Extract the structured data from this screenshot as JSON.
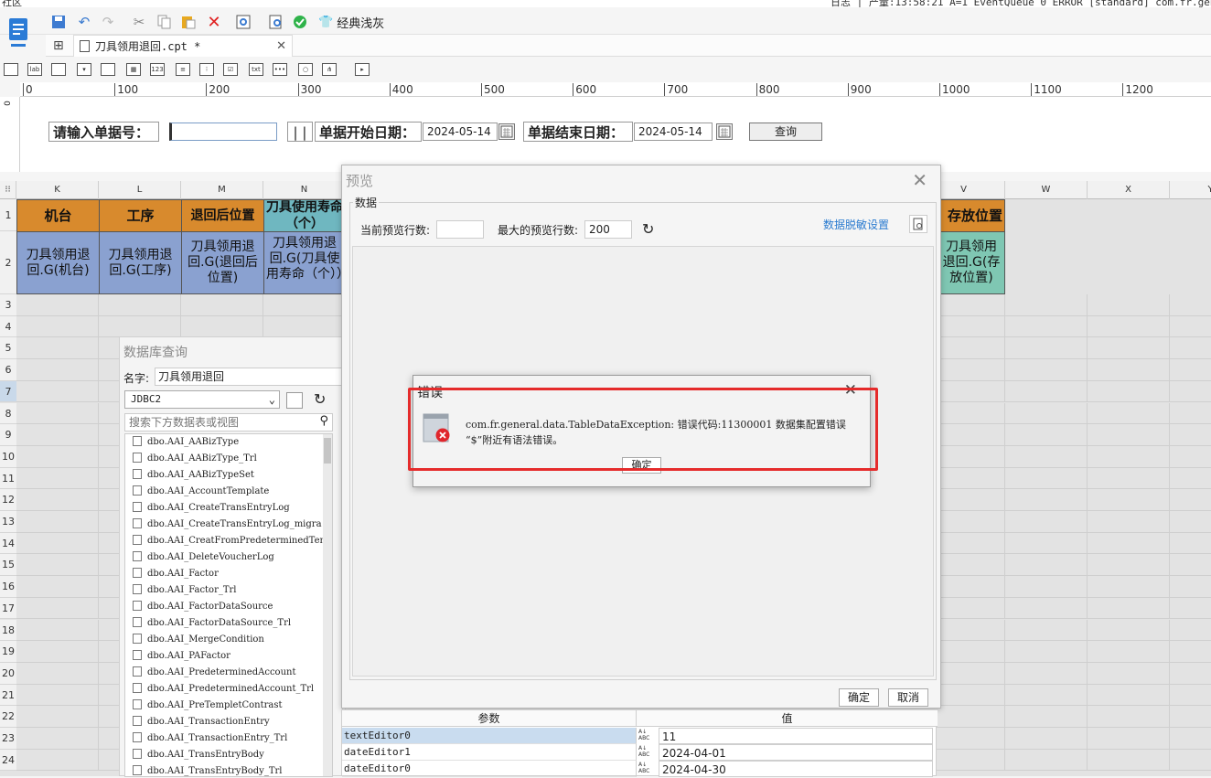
{
  "status_bar": {
    "log_text": "日志 | 产量:13:58:21 A=1 EventQueue 0 ERROR [standard] com.fr.general",
    "left_text": "社区"
  },
  "toolbar": {
    "theme_label": "经典浅灰"
  },
  "tabs": [
    {
      "label": "刀具领用退回.cpt *"
    }
  ],
  "ruler": {
    "marks": [
      "0",
      "100",
      "200",
      "300",
      "400",
      "500",
      "600",
      "700",
      "800",
      "900",
      "1000",
      "1100",
      "1200"
    ]
  },
  "params": {
    "doc_no_label": "请输入单据号：",
    "doc_no_value": "",
    "sep_label": "| |",
    "start_label": "单据开始日期：",
    "start_value": "2024-05-14",
    "end_label": "单据结束日期：",
    "end_value": "2024-05-14",
    "query_button": "查询"
  },
  "sheet": {
    "columns": [
      {
        "label": "K"
      },
      {
        "label": "L"
      },
      {
        "label": "M"
      },
      {
        "label": "N"
      },
      {
        "label": "V"
      },
      {
        "label": "W"
      },
      {
        "label": "X"
      },
      {
        "label": "Y"
      }
    ],
    "rows": [
      "1",
      "2",
      "3",
      "4",
      "5",
      "6",
      "7",
      "8",
      "9",
      "10",
      "11",
      "12",
      "13",
      "14",
      "15",
      "16",
      "17",
      "18",
      "19",
      "20",
      "21",
      "22",
      "23",
      "24"
    ],
    "headers": [
      "机台",
      "工序",
      "退回后位置",
      "刀具使用寿命（个）",
      "存放位置"
    ],
    "data": [
      "刀具领用退回.G(机台)",
      "刀具领用退回.G(工序)",
      "刀具领用退回.G(退回后位置)",
      "刀具领用退回.G(刀具使用寿命（个））",
      "刀具领用退回.G(存放位置)"
    ]
  },
  "db_panel": {
    "title": "数据库查询",
    "name_label": "名字:",
    "name_value": "刀具领用退回",
    "connection": "JDBC2",
    "search_placeholder": "搜索下方数据表或视图",
    "tables": [
      "dbo.AAI_AABizType",
      "dbo.AAI_AABizType_Trl",
      "dbo.AAI_AABizTypeSet",
      "dbo.AAI_AccountTemplate",
      "dbo.AAI_CreateTransEntryLog",
      "dbo.AAI_CreateTransEntryLog_migra",
      "dbo.AAI_CreatFromPredeterminedTem",
      "dbo.AAI_DeleteVoucherLog",
      "dbo.AAI_Factor",
      "dbo.AAI_Factor_Trl",
      "dbo.AAI_FactorDataSource",
      "dbo.AAI_FactorDataSource_Trl",
      "dbo.AAI_MergeCondition",
      "dbo.AAI_PAFactor",
      "dbo.AAI_PredeterminedAccount",
      "dbo.AAI_PredeterminedAccount_Trl",
      "dbo.AAI_PreTempletContrast",
      "dbo.AAI_TransactionEntry",
      "dbo.AAI_TransactionEntry_Trl",
      "dbo.AAI_TransEntryBody",
      "dbo.AAI_TransEntryBody_Trl"
    ]
  },
  "preview": {
    "title": "预览",
    "group_label": "数据",
    "current_rows_label": "当前预览行数:",
    "current_rows_value": "",
    "max_rows_label": "最大的预览行数:",
    "max_rows_value": "200",
    "desensitize_link": "数据脱敏设置",
    "ok_button": "确定",
    "cancel_button": "取消"
  },
  "error_dialog": {
    "title": "错误",
    "message_line1": "com.fr.general.data.TableDataException: 错误代码:11300001 数据集配置错误",
    "message_line2": "“$”附近有语法错误。",
    "ok_button": "确定"
  },
  "param_table": {
    "col_param": "参数",
    "col_value": "值",
    "rows": [
      {
        "name": "textEditor0",
        "value": "11"
      },
      {
        "name": "dateEditor1",
        "value": "2024-04-01"
      },
      {
        "name": "dateEditor0",
        "value": "2024-04-30"
      }
    ]
  }
}
